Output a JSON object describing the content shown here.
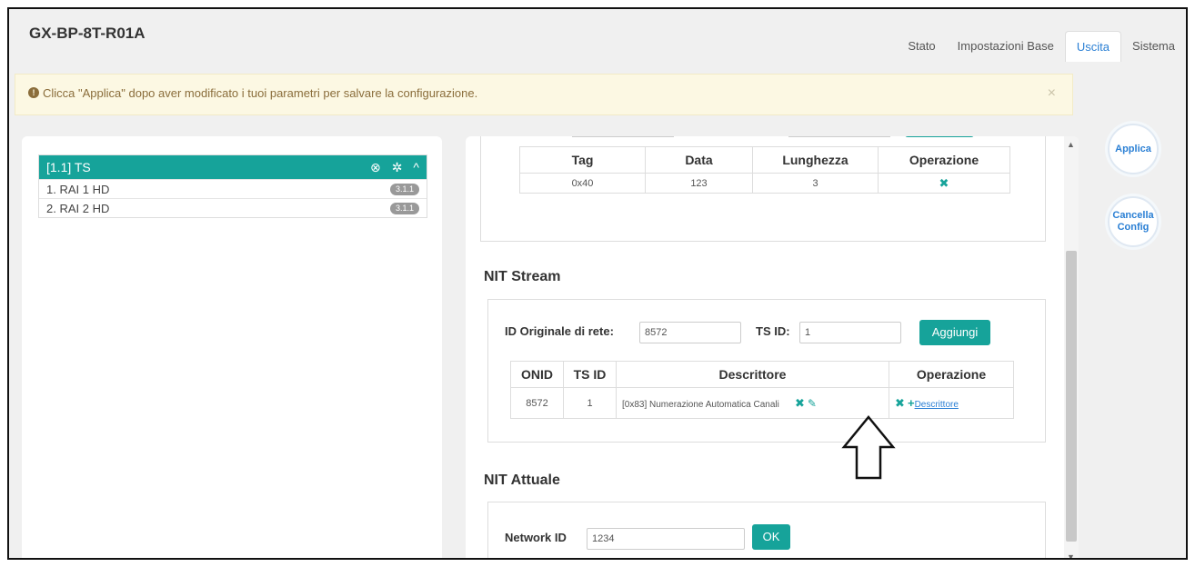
{
  "app": {
    "title": "GX-BP-8T-R01A"
  },
  "nav": {
    "tabs": [
      "Stato",
      "Impostazioni Base",
      "Uscita",
      "Sistema"
    ],
    "active": "Uscita"
  },
  "alert": {
    "icon": "info-icon",
    "message": "Clicca \"Applica\" dopo aver modificato i tuoi parametri per salvare la configurazione.",
    "close": "×"
  },
  "ts_panel": {
    "header": "[1.1] TS",
    "services": [
      {
        "name": "1. RAI 1 HD",
        "badge": "3.1.1"
      },
      {
        "name": "2. RAI 2 HD",
        "badge": "3.1.1"
      }
    ]
  },
  "descriptor_table": {
    "headers": [
      "Tag",
      "Data",
      "Lunghezza",
      "Operazione"
    ],
    "rows": [
      {
        "tag": "0x40",
        "data": "123",
        "length": "3"
      }
    ]
  },
  "nit_stream": {
    "title": "NIT Stream",
    "onid_label": "ID Originale di rete:",
    "onid_value": "8572",
    "tsid_label": "TS ID:",
    "tsid_value": "1",
    "add_button": "Aggiungi",
    "headers": [
      "ONID",
      "TS ID",
      "Descrittore",
      "Operazione"
    ],
    "rows": [
      {
        "onid": "8572",
        "tsid": "1",
        "descriptor": "[0x83] Numerazione Automatica Canali",
        "link": "Descrittore"
      }
    ]
  },
  "nit_actual": {
    "title": "NIT Attuale",
    "network_label": "Network ID",
    "network_value": "1234",
    "ok_button": "OK"
  },
  "side": {
    "apply": "Applica",
    "clear_1": "Cancella",
    "clear_2": "Config"
  },
  "colors": {
    "accent": "#16a39a",
    "link": "#2a7fd4",
    "alert_bg": "#fcf8e3"
  }
}
